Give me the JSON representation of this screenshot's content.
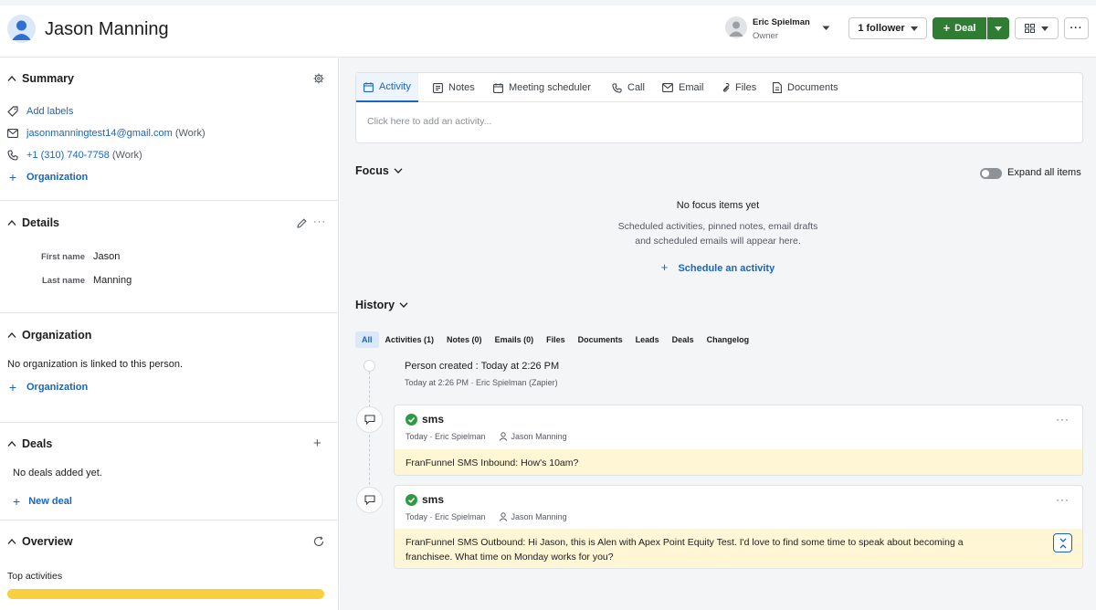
{
  "header": {
    "person_name": "Jason Manning",
    "owner_name": "Eric Spielman",
    "owner_role": "Owner",
    "follower_label": "1 follower",
    "deal_button_label": "Deal",
    "colors": {
      "brand_green": "#2f7d32",
      "link_blue": "#1a64c2"
    }
  },
  "summary": {
    "title": "Summary",
    "add_labels": "Add labels",
    "email": "jasonmanningtest14@gmail.com",
    "email_type": "(Work)",
    "phone": "+1 (310) 740-7758",
    "phone_type": "(Work)",
    "organization_link": "Organization"
  },
  "details": {
    "title": "Details",
    "fields": [
      {
        "label": "First name",
        "value": "Jason"
      },
      {
        "label": "Last name",
        "value": "Manning"
      }
    ]
  },
  "organization": {
    "title": "Organization",
    "empty_text": "No organization is linked to this person.",
    "add_link": "Organization"
  },
  "deals": {
    "title": "Deals",
    "empty_text": "No deals added yet.",
    "new_deal": "New deal"
  },
  "overview": {
    "title": "Overview",
    "top_activities": "Top activities",
    "top_activities_fill": 1.0
  },
  "composer": {
    "tabs": [
      {
        "label": "Activity",
        "icon": "calendar-icon"
      },
      {
        "label": "Notes",
        "icon": "note-icon"
      },
      {
        "label": "Meeting scheduler",
        "icon": "calendar-icon"
      },
      {
        "label": "Call",
        "icon": "phone-icon"
      },
      {
        "label": "Email",
        "icon": "mail-icon"
      },
      {
        "label": "Files",
        "icon": "paperclip-icon"
      },
      {
        "label": "Documents",
        "icon": "document-icon"
      }
    ],
    "placeholder": "Click here to add an activity..."
  },
  "focus": {
    "title": "Focus",
    "expand_label": "Expand all items",
    "empty_title": "No focus items yet",
    "empty_line1": "Scheduled activities, pinned notes, email drafts",
    "empty_line2": "and scheduled emails will appear here.",
    "schedule_link": "Schedule an activity"
  },
  "history": {
    "title": "History",
    "filters": [
      "All",
      "Activities (1)",
      "Notes (0)",
      "Emails (0)",
      "Files",
      "Documents",
      "Leads",
      "Deals",
      "Changelog"
    ],
    "created_title": "Person created : Today at 2:26 PM",
    "created_meta": "Today at 2:26 PM · Eric Spielman (Zapier)",
    "items": [
      {
        "title": "sms",
        "meta_time": "Today · Eric Spielman",
        "meta_person": "Jason Manning",
        "body": "FranFunnel SMS Inbound: How's 10am?"
      },
      {
        "title": "sms",
        "meta_time": "Today · Eric Spielman",
        "meta_person": "Jason Manning",
        "body": "FranFunnel SMS Outbound: Hi Jason, this is Alen with Apex Point Equity Test. I'd love to find some time to speak about becoming a franchisee. What time on Monday works for you?"
      }
    ]
  }
}
